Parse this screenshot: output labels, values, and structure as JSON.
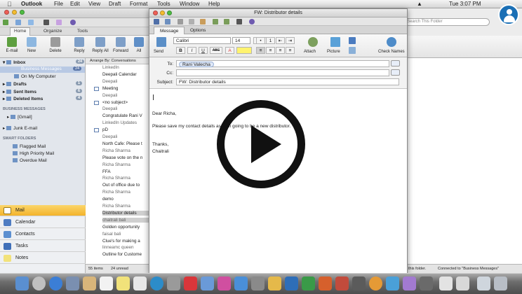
{
  "menubar": {
    "app": "Outlook",
    "items": [
      "File",
      "Edit",
      "View",
      "Draft",
      "Format",
      "Tools",
      "Window",
      "Help"
    ],
    "clock": "Tue 3:07 PM"
  },
  "outlook": {
    "ribbon_tabs": [
      "Home",
      "Organize",
      "Tools"
    ],
    "ribbon_buttons": [
      "E-mail",
      "New",
      "Delete",
      "Reply",
      "Reply All",
      "Forward",
      "All"
    ],
    "arrange_label": "Arrange By: Conversations",
    "search_placeholder": "Search This Folder",
    "sidebar": {
      "inbox": {
        "label": "Inbox",
        "count": "24"
      },
      "business": {
        "label": "Business Messages",
        "count": "24"
      },
      "on_my_computer": "On My Computer",
      "drafts": {
        "label": "Drafts",
        "count": "1"
      },
      "sent": {
        "label": "Sent Items",
        "count": "6"
      },
      "deleted": {
        "label": "Deleted Items",
        "count": "4"
      },
      "business_header": "BUSINESS MESSAGES",
      "gmail": "[Gmail]",
      "junk": "Junk E-mail",
      "smart_header": "SMART FOLDERS",
      "smart": [
        "Flagged Mail",
        "High Priority Mail",
        "Overdue Mail"
      ]
    },
    "nav": [
      "Mail",
      "Calendar",
      "Contacts",
      "Tasks",
      "Notes"
    ],
    "messages": [
      {
        "t": "LinkedIn",
        "cls": "sub"
      },
      {
        "t": "Deepali Calendar",
        "cls": ""
      },
      {
        "t": "Deepali",
        "cls": "sub"
      },
      {
        "t": "Meeting",
        "cls": "",
        "icon": true
      },
      {
        "t": "Deepali",
        "cls": "sub"
      },
      {
        "t": "<no subject>",
        "cls": "",
        "icon": true
      },
      {
        "t": "Deepali",
        "cls": "sub"
      },
      {
        "t": "Congratulate Rani V",
        "cls": ""
      },
      {
        "t": "LinkedIn Updates",
        "cls": "sub"
      },
      {
        "t": "pD",
        "cls": "",
        "icon": true
      },
      {
        "t": "Deepali",
        "cls": "sub"
      },
      {
        "t": "North Cafe: Please t",
        "cls": ""
      },
      {
        "t": "Richa Sharma",
        "cls": "sub"
      },
      {
        "t": "Please vote on the n",
        "cls": ""
      },
      {
        "t": "Richa Sharma",
        "cls": "sub"
      },
      {
        "t": "FFA",
        "cls": ""
      },
      {
        "t": "Richa Sharma",
        "cls": "sub"
      },
      {
        "t": "Out of office due to",
        "cls": ""
      },
      {
        "t": "Richa Sharma",
        "cls": "sub"
      },
      {
        "t": "demo",
        "cls": ""
      },
      {
        "t": "Richa Sharma",
        "cls": "sub"
      },
      {
        "t": "Distributor details",
        "cls": "sel"
      },
      {
        "t": "chaitrali bali",
        "cls": "sel sub"
      },
      {
        "t": "Golden opportunity",
        "cls": ""
      },
      {
        "t": "faisal bali",
        "cls": "sub"
      },
      {
        "t": "Clue's for making a",
        "cls": ""
      },
      {
        "t": "linneamc queen",
        "cls": "sub"
      },
      {
        "t": "Outline for Custome",
        "cls": ""
      }
    ],
    "status_items": "55 items",
    "status_unread": "24 unread",
    "status_right_a": "this folder.",
    "status_right_b": "Connected to \"Business Messages\"",
    "right_ribbon_labels": [
      "Picture",
      "Check Names"
    ]
  },
  "compose": {
    "window_title": "FW: Distributor details",
    "tabs": [
      "Message",
      "Options"
    ],
    "font_name": "Calibri",
    "font_size": "14",
    "send_label": "Send",
    "attach_label": "Attach",
    "picture_label": "Picture",
    "check_names_label": "Check Names",
    "format_buttons": [
      "B",
      "I",
      "U",
      "ABC"
    ],
    "to_label": "To:",
    "to_value": "Rani Valecha",
    "cc_label": "Cc:",
    "cc_value": "",
    "subject_label": "Subject:",
    "subject_value": "FW: Distributor details",
    "body_lines": [
      "Dear Richa,",
      "Please save my contact details as I am going to be a new distributor.",
      "Thanks,",
      "Chaitrali"
    ]
  },
  "colors": {
    "nav_selected": "#f3b32c",
    "sidebar_selected": "#b8c9e4",
    "avatar": "#1a6fb5"
  },
  "icons": [
    "apple-icon",
    "wifi-icon",
    "search-icon",
    "play-icon",
    "user-avatar-icon"
  ]
}
